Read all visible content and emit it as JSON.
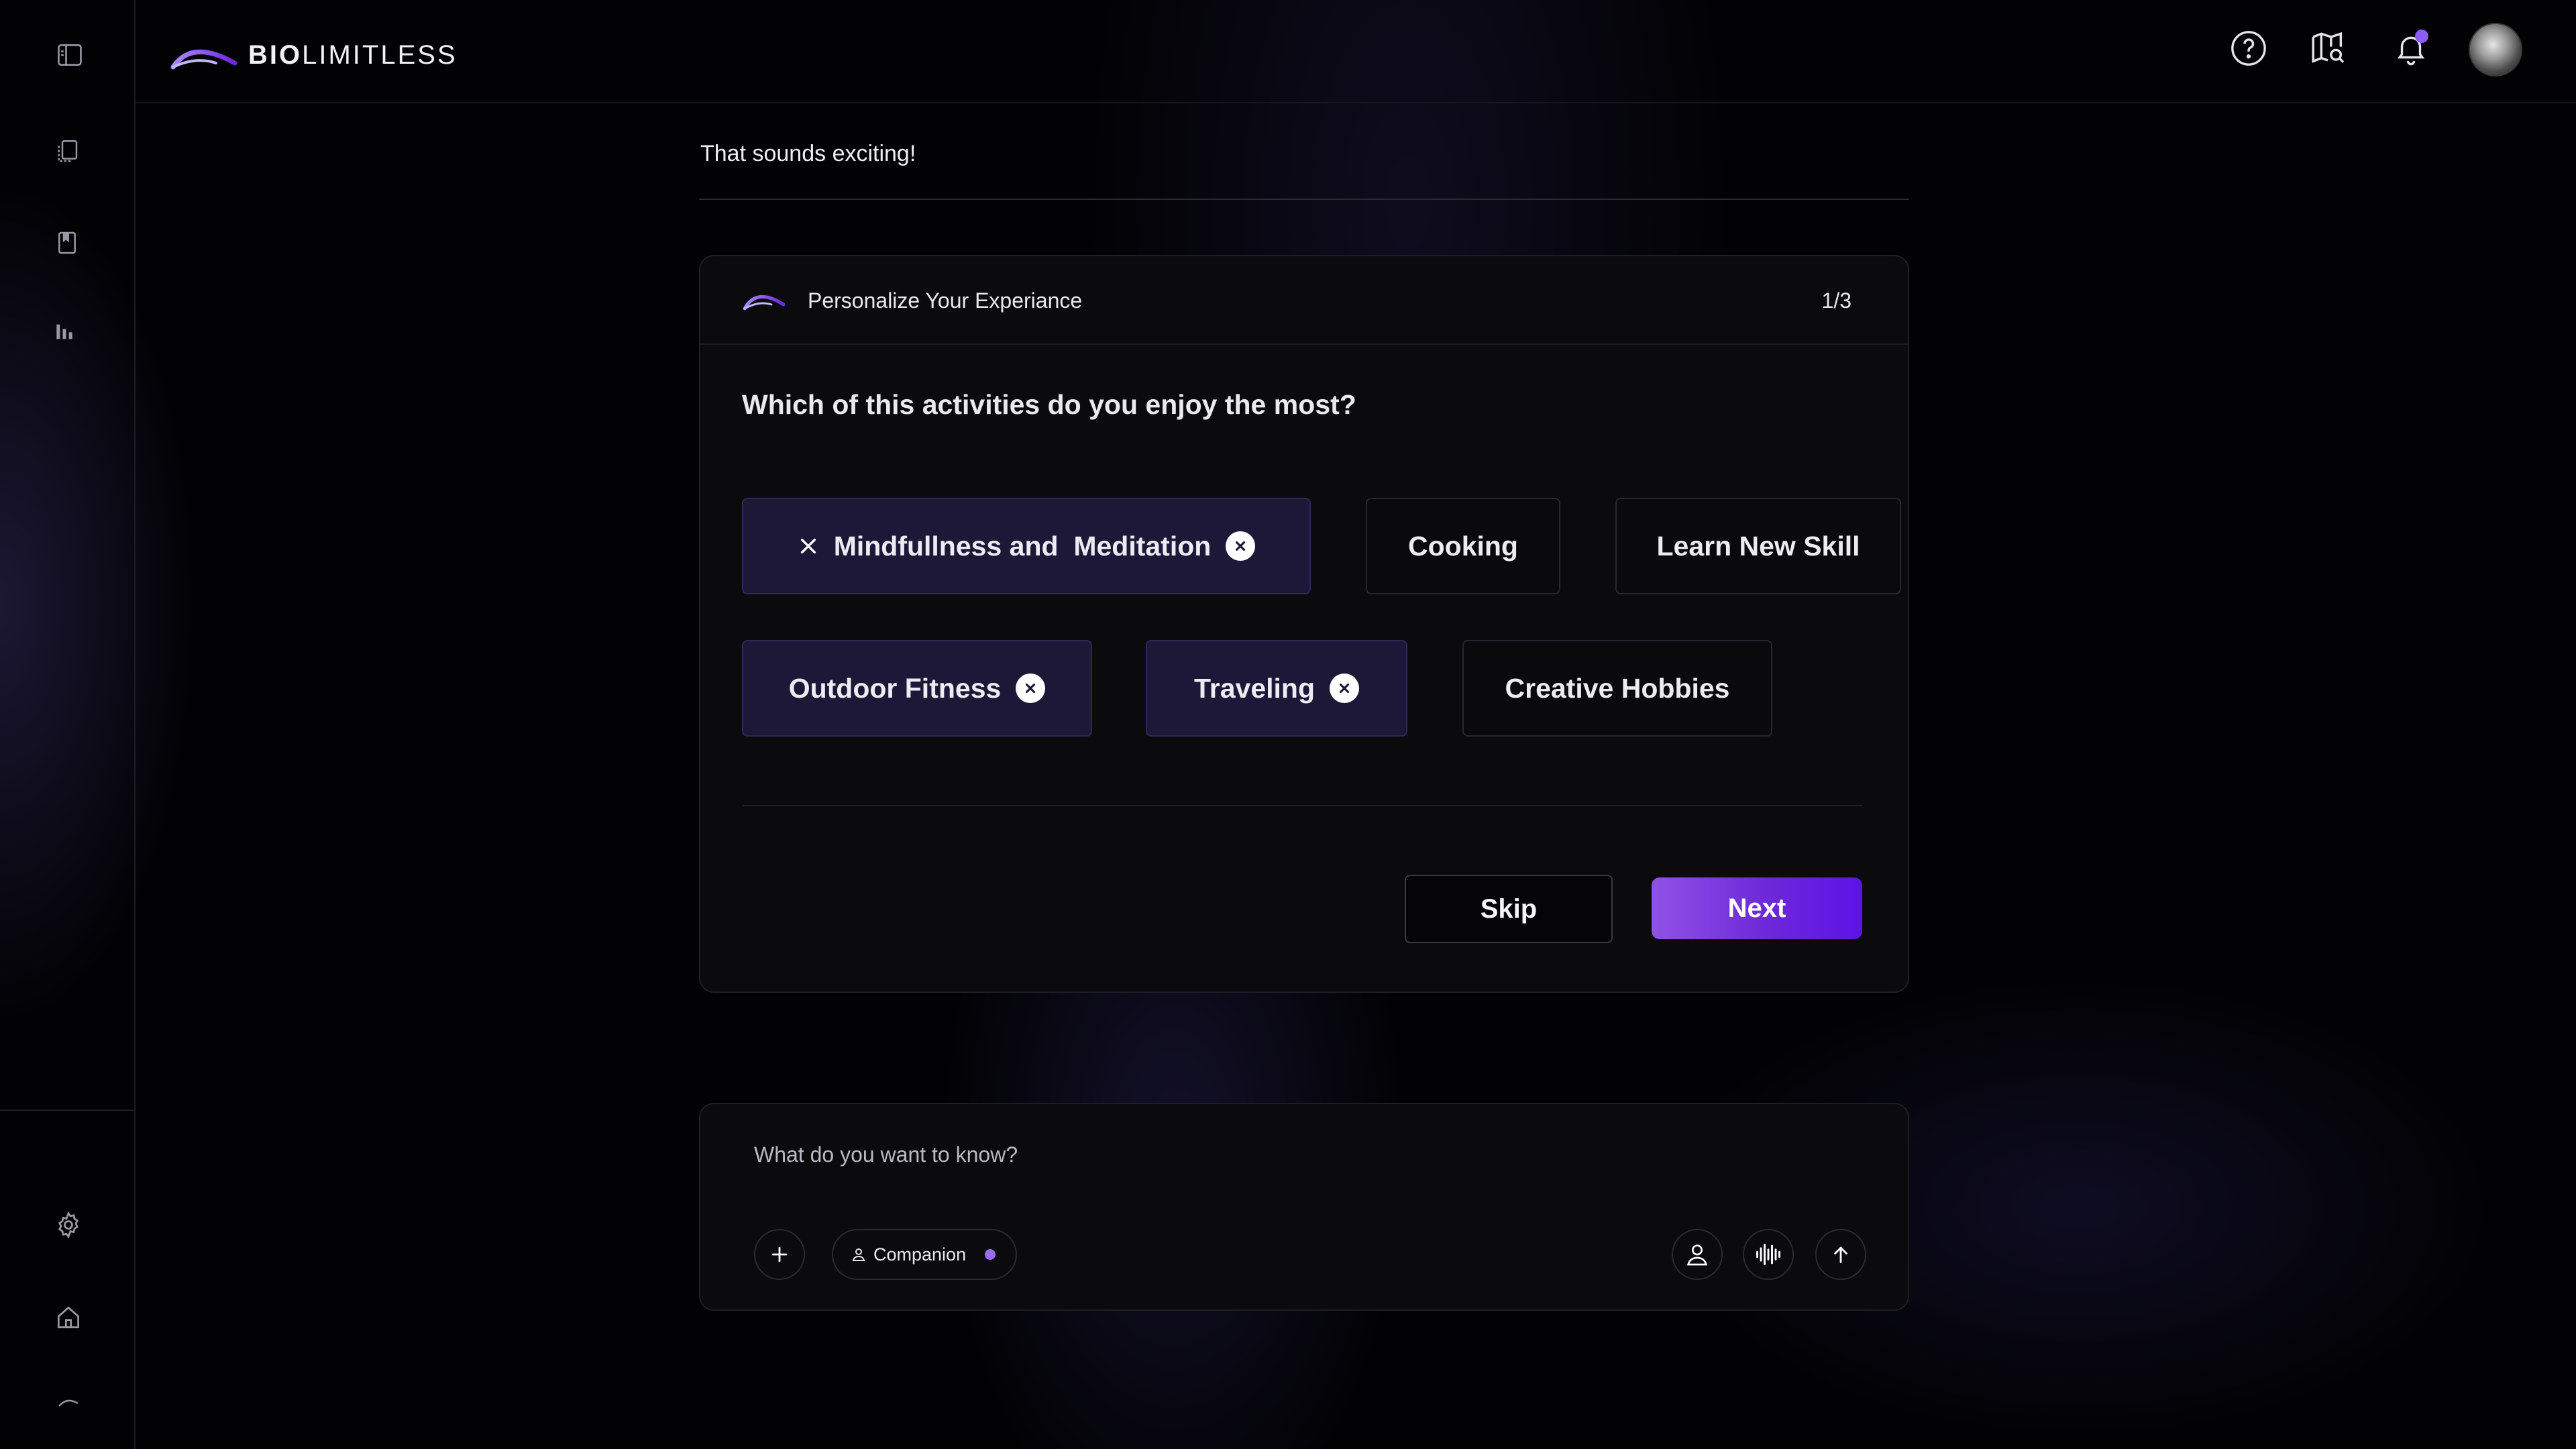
{
  "app": {
    "logo": {
      "bold": "BIO",
      "light": "LIMITLESS"
    }
  },
  "sidebar": {
    "top_icons": [
      "sidebar-toggle-icon",
      "documents-icon",
      "bookmark-icon",
      "analytics-icon"
    ],
    "bottom_icons": [
      "gear-icon",
      "home-icon",
      "logo-mark-icon"
    ]
  },
  "header": {
    "icons": [
      "help-icon",
      "map-search-icon",
      "bell-icon"
    ],
    "notification_dot_color": "#8b5cf6"
  },
  "conversation": {
    "message": "That sounds exciting!"
  },
  "personalize_card": {
    "title": "Personalize Your Experiance",
    "step": "1/3",
    "question": "Which of this activities do you enjoy the most?",
    "options": [
      {
        "label": "Mindfullness and  Meditation",
        "selected": true
      },
      {
        "label": "Cooking",
        "selected": false
      },
      {
        "label": "Learn New Skill",
        "selected": false
      },
      {
        "label": "Outdoor Fitness",
        "selected": true
      },
      {
        "label": "Traveling",
        "selected": true
      },
      {
        "label": "Creative Hobbies",
        "selected": false
      }
    ],
    "skip_label": "Skip",
    "next_label": "Next"
  },
  "composer": {
    "placeholder": "What do you want to know?",
    "value": "",
    "companion_label": "Companion",
    "companion_dot_color": "#9b6cf0"
  },
  "colors": {
    "accent": "#7c3aed",
    "selected_chip_bg": "#1d1838"
  }
}
